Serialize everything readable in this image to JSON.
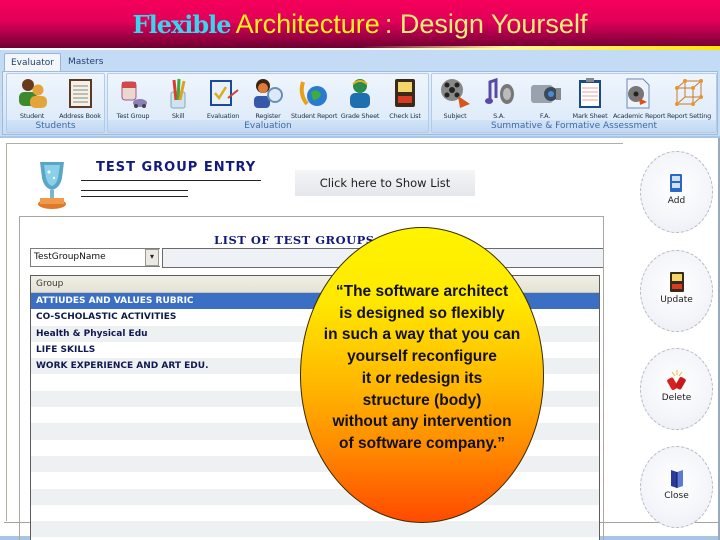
{
  "slide_title": {
    "part1": "Flexible",
    "part2": "Architecture",
    "part3": " : Design Yourself"
  },
  "app": {
    "tabs": [
      {
        "label": "Evaluator",
        "active": true
      },
      {
        "label": "Masters",
        "active": false
      }
    ],
    "ribbon_groups": [
      {
        "label": "Students",
        "buttons": [
          {
            "label": "Student",
            "icon": "students-icon"
          },
          {
            "label": "Address Book",
            "icon": "address-book-icon"
          }
        ]
      },
      {
        "label": "Evaluation",
        "buttons": [
          {
            "label": "Test Group",
            "icon": "test-group-icon"
          },
          {
            "label": "Skill",
            "icon": "skill-icon"
          },
          {
            "label": "Evaluation",
            "icon": "evaluation-icon"
          },
          {
            "label": "Register",
            "icon": "register-icon"
          },
          {
            "label": "Student Report",
            "icon": "student-report-icon"
          },
          {
            "label": "Grade Sheet",
            "icon": "grade-sheet-icon"
          },
          {
            "label": "Check List",
            "icon": "check-list-icon"
          }
        ]
      },
      {
        "label": "Summative & Formative Assessment",
        "buttons": [
          {
            "label": "Subject",
            "icon": "subject-icon"
          },
          {
            "label": "S.A.",
            "icon": "sa-icon"
          },
          {
            "label": "F.A.",
            "icon": "fa-icon"
          },
          {
            "label": "Mark Sheet",
            "icon": "mark-sheet-icon"
          },
          {
            "label": "Academic Report",
            "icon": "academic-report-icon"
          },
          {
            "label": "Report Setting",
            "icon": "report-setting-icon"
          }
        ]
      }
    ],
    "form": {
      "title": "TEST GROUP ENTRY",
      "show_list_button": "Click here to Show List",
      "list_title": "LIST OF TEST GROUPS",
      "filter_field": "TestGroupName",
      "filter_value": "",
      "grid": {
        "column": "Group",
        "rows": [
          {
            "name": "ATTIUDES AND VALUES RUBRIC",
            "selected": true
          },
          {
            "name": "CO-SCHOLASTIC ACTIVITIES",
            "selected": false
          },
          {
            "name": "Health & Physical Edu",
            "selected": false
          },
          {
            "name": "LIFE SKILLS",
            "selected": false
          },
          {
            "name": "WORK EXPERIENCE AND ART EDU.",
            "selected": false
          }
        ]
      }
    },
    "actions": [
      {
        "label": "Add",
        "icon": "add-icon"
      },
      {
        "label": "Update",
        "icon": "update-icon"
      },
      {
        "label": "Delete",
        "icon": "delete-icon"
      },
      {
        "label": "Close",
        "icon": "close-icon"
      }
    ]
  },
  "callout": {
    "lines": [
      "“The software architect",
      "is designed so flexibly",
      "in such a way that you can",
      "yourself reconfigure",
      "it or redesign its",
      "structure (body)",
      "without any intervention",
      "of software company.”"
    ]
  }
}
